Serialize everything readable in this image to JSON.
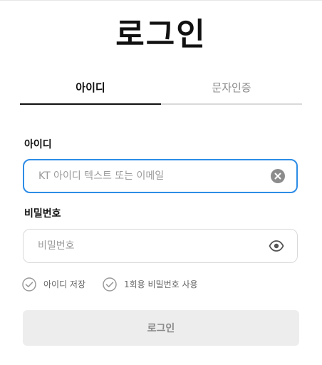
{
  "title": "로그인",
  "tabs": [
    {
      "label": "아이디",
      "active": true
    },
    {
      "label": "문자인증",
      "active": false
    }
  ],
  "id_field": {
    "label": "아이디",
    "placeholder": "KT 아이디 텍스트 또는 이메일",
    "value": "",
    "icon": "clear-icon"
  },
  "password_field": {
    "label": "비밀번호",
    "placeholder": "비밀번호",
    "value": "",
    "icon": "eye-icon"
  },
  "options": [
    {
      "label": "아이디 저장",
      "checked": false
    },
    {
      "label": "1회용 비밀번호 사용",
      "checked": false
    }
  ],
  "login_button": {
    "label": "로그인"
  },
  "colors": {
    "focus_border": "#2d8ce6",
    "button_bg": "#ededed",
    "active_tab": "#111111",
    "inactive_tab": "#8a8a8a"
  }
}
